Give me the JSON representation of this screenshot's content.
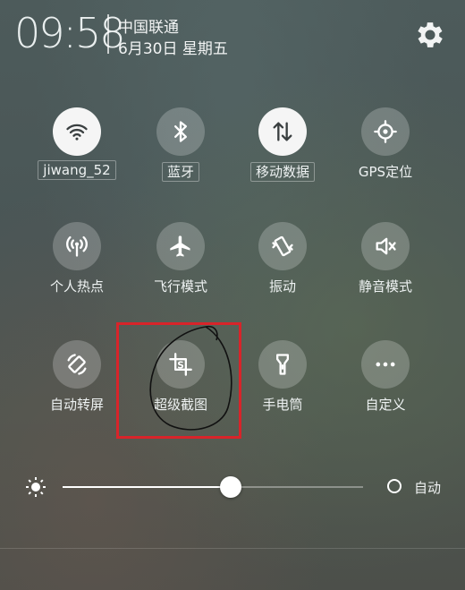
{
  "status_bar": {
    "time": "09:58",
    "carrier": "中国联通",
    "date": "6月30日 星期五"
  },
  "tiles": [
    {
      "label": "jiwang_52",
      "icon": "wifi-icon",
      "state": "on",
      "boxed": true
    },
    {
      "label": "蓝牙",
      "icon": "bluetooth-icon",
      "state": "off",
      "boxed": true
    },
    {
      "label": "移动数据",
      "icon": "mobile-data-icon",
      "state": "on",
      "boxed": true
    },
    {
      "label": "GPS定位",
      "icon": "gps-icon",
      "state": "off",
      "boxed": false
    },
    {
      "label": "个人热点",
      "icon": "hotspot-icon",
      "state": "off",
      "boxed": false
    },
    {
      "label": "飞行模式",
      "icon": "airplane-icon",
      "state": "off",
      "boxed": false
    },
    {
      "label": "振动",
      "icon": "vibrate-icon",
      "state": "off",
      "boxed": false
    },
    {
      "label": "静音模式",
      "icon": "mute-icon",
      "state": "off",
      "boxed": false
    },
    {
      "label": "自动转屏",
      "icon": "auto-rotate-icon",
      "state": "off",
      "boxed": false
    },
    {
      "label": "超级截图",
      "icon": "super-screenshot-icon",
      "state": "off",
      "boxed": false
    },
    {
      "label": "手电筒",
      "icon": "flashlight-icon",
      "state": "off",
      "boxed": false
    },
    {
      "label": "自定义",
      "icon": "more-icon",
      "state": "off",
      "boxed": false
    }
  ],
  "brightness": {
    "level_percent": 56,
    "auto_label": "自动"
  },
  "highlight": {
    "target": "超级截图",
    "color": "#d8242a"
  }
}
